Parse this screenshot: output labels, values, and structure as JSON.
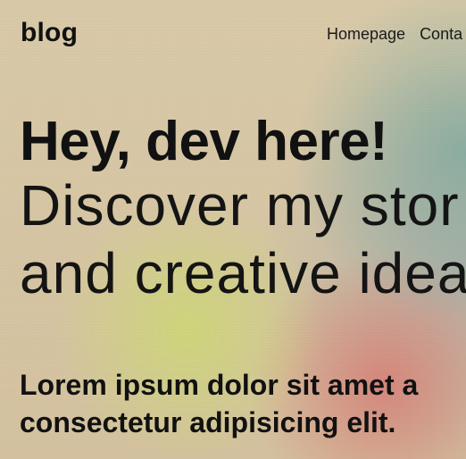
{
  "header": {
    "logo": "blog",
    "nav": [
      {
        "label": "Homepage"
      },
      {
        "label": "Conta"
      }
    ]
  },
  "hero": {
    "title": "Hey, dev here!",
    "subtitle_line1": "Discover my stor",
    "subtitle_line2": "and creative idea"
  },
  "lead": {
    "line1": "Lorem ipsum dolor sit amet a",
    "line2": "consectetur adipisicing elit."
  },
  "colors": {
    "background_base": "#d7c8a6",
    "blob_teal": "#80aaa0",
    "blob_lime": "#cdd678",
    "blob_pink": "#d68278",
    "text": "#111111"
  }
}
